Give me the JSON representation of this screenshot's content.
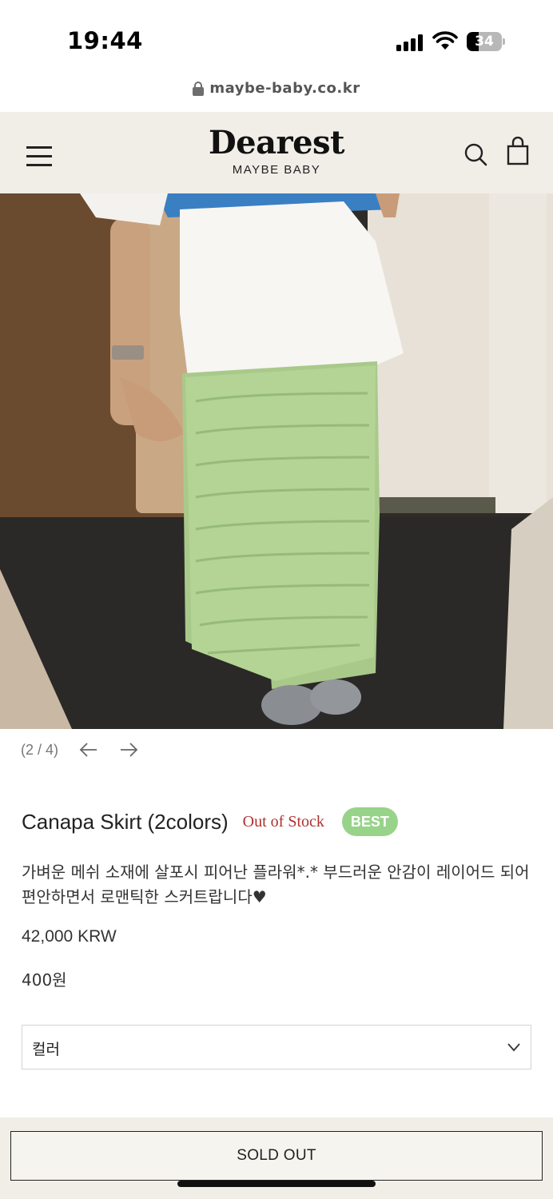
{
  "status_bar": {
    "time": "19:44",
    "battery": "34",
    "battery_level": 0.34
  },
  "url": "maybe-baby.co.kr",
  "header": {
    "logo": "Dearest",
    "logo_sub": "MAYBE BABY",
    "icons": [
      "menu-icon",
      "search-icon",
      "shopping-bag-icon"
    ]
  },
  "gallery": {
    "counter": "(2 / 4)",
    "icons": [
      "arrow-left-icon",
      "arrow-right-icon"
    ]
  },
  "product": {
    "title": "Canapa Skirt (2colors)",
    "stock_status": "Out of Stock",
    "badge": "BEST",
    "description": "가벼운 메쉬 소재에 살포시 피어난 플라워*.* 부드러운 안감이 레이어드 되어 편안하면서 로맨틱한 스커트랍니다♥",
    "price": "42,000 KRW",
    "points": "400원"
  },
  "option": {
    "label": "컬러"
  },
  "purchase": {
    "button_label": "SOLD OUT"
  },
  "colors": {
    "header_bg": "#f1eee8",
    "badge_bg": "#98d38a",
    "stock_text": "#b03030"
  }
}
